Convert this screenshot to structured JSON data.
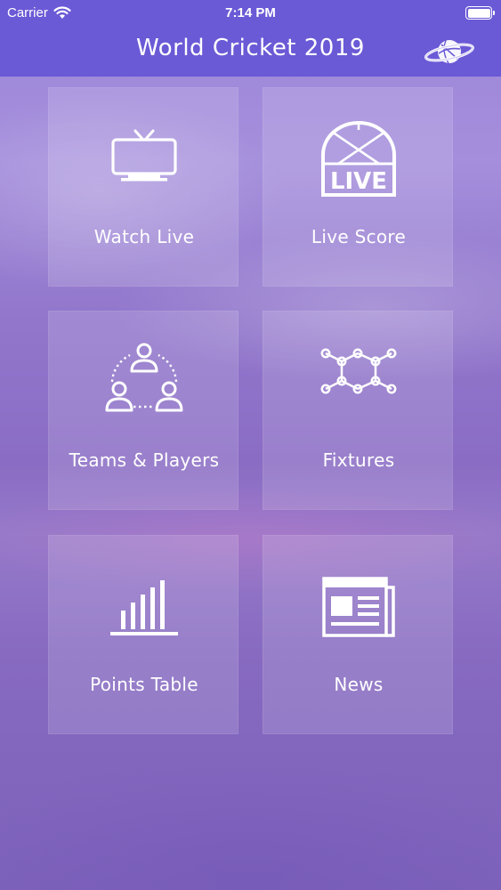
{
  "status_bar": {
    "carrier": "Carrier",
    "time": "7:14 PM",
    "wifi_icon": "wifi-icon",
    "battery_icon": "battery-icon"
  },
  "nav": {
    "title": "World Cricket 2019",
    "right_icon": "globe-icon"
  },
  "colors": {
    "nav_background": "#6a5ad6",
    "tile_background": "rgba(255,255,255,0.14)",
    "text": "#ffffff"
  },
  "tiles": [
    {
      "label": "Watch Live",
      "icon": "tv-icon"
    },
    {
      "label": "Live Score",
      "icon": "live-score-icon",
      "icon_text": "LIVE"
    },
    {
      "label": "Teams & Players",
      "icon": "team-icon"
    },
    {
      "label": "Fixtures",
      "icon": "fixtures-icon"
    },
    {
      "label": "Points Table",
      "icon": "bar-chart-icon"
    },
    {
      "label": "News",
      "icon": "newspaper-icon"
    }
  ]
}
